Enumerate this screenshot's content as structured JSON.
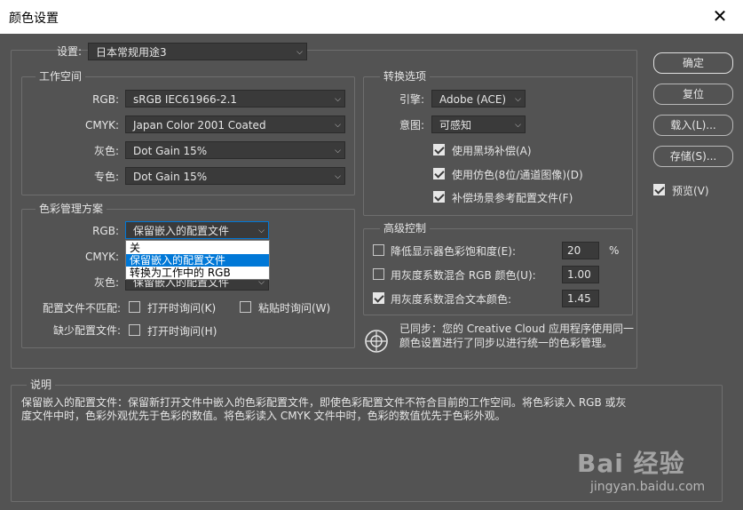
{
  "window": {
    "title": "颜色设置",
    "close_glyph": "✕"
  },
  "settings": {
    "label": "设置:",
    "value": "日本常规用途3"
  },
  "working_spaces": {
    "title": "工作空间",
    "rgb": {
      "label": "RGB:",
      "value": "sRGB IEC61966-2.1"
    },
    "cmyk": {
      "label": "CMYK:",
      "value": "Japan Color 2001 Coated"
    },
    "gray": {
      "label": "灰色:",
      "value": "Dot Gain 15%"
    },
    "spot": {
      "label": "专色:",
      "value": "Dot Gain 15%"
    }
  },
  "color_management": {
    "title": "色彩管理方案",
    "rgb": {
      "label": "RGB:",
      "value": "保留嵌入的配置文件"
    },
    "cmyk": {
      "label": "CMYK:"
    },
    "gray": {
      "label": "灰色:",
      "value": "保留嵌入的配置文件"
    },
    "dropdown_options": [
      {
        "label": "关",
        "highlighted": false
      },
      {
        "label": "保留嵌入的配置文件",
        "highlighted": true
      },
      {
        "label": "转换为工作中的 RGB",
        "highlighted": false
      }
    ],
    "mismatch": {
      "label": "配置文件不匹配:",
      "ask_open": "打开时询问(K)",
      "ask_paste": "粘贴时询问(W)",
      "ask_open_checked": false,
      "ask_paste_checked": false
    },
    "missing": {
      "label": "缺少配置文件:",
      "ask_open": "打开时询问(H)",
      "ask_open_checked": false
    }
  },
  "conversion": {
    "title": "转换选项",
    "engine": {
      "label": "引擎:",
      "value": "Adobe (ACE)"
    },
    "intent": {
      "label": "意图:",
      "value": "可感知"
    },
    "options": [
      {
        "label": "使用黑场补偿(A)",
        "checked": true
      },
      {
        "label": "使用仿色(8位/通道图像)(D)",
        "checked": true
      },
      {
        "label": "补偿场景参考配置文件(F)",
        "checked": true
      }
    ]
  },
  "advanced": {
    "title": "高级控制",
    "desaturate": {
      "label": "降低显示器色彩饱和度(E):",
      "value": "20",
      "unit": "%",
      "checked": false
    },
    "blend_rgb": {
      "label": "用灰度系数混合 RGB 颜色(U):",
      "value": "1.00",
      "checked": false
    },
    "blend_text": {
      "label": "用灰度系数混合文本颜色:",
      "value": "1.45",
      "checked": true
    }
  },
  "sync": {
    "text": "已同步：您的 Creative Cloud 应用程序使用同一颜色设置进行了同步以进行统一的色彩管理。"
  },
  "buttons": {
    "ok": "确定",
    "reset": "复位",
    "load": "载入(L)...",
    "save": "存储(S)...",
    "preview": "预览(V)",
    "preview_checked": true
  },
  "description": {
    "title": "说明",
    "text": "保留嵌入的配置文件：保留新打开文件中嵌入的色彩配置文件，即使色彩配置文件不符合目前的工作空间。将色彩读入 RGB 或灰度文件中时，色彩外观优先于色彩的数值。将色彩读入 CMYK 文件中时，色彩的数值优先于色彩外观。"
  },
  "watermark": {
    "logo": "Bai 经验",
    "url": "jingyan.baidu.com"
  }
}
